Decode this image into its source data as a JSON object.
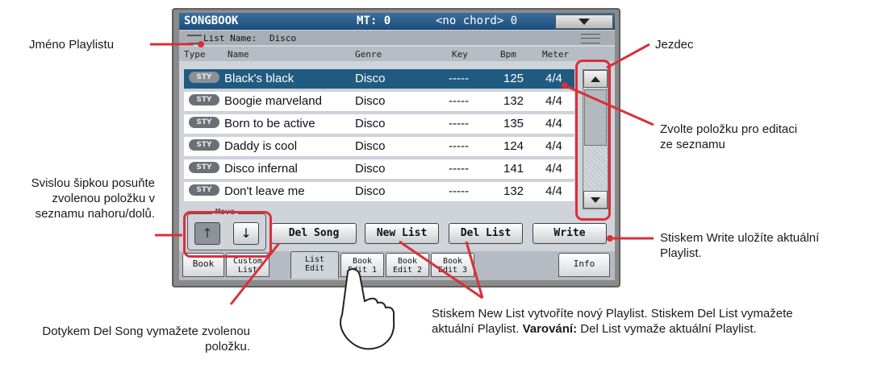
{
  "screen": {
    "title": "SONGBOOK",
    "mt": "MT: 0",
    "chord": "<no chord> 0",
    "list_name_label": "List Name:",
    "list_name_value": "Disco",
    "columns": [
      "Type",
      "Name",
      "Genre",
      "Key",
      "Bpm",
      "Meter"
    ],
    "rows": [
      {
        "type": "STY",
        "name": "Black's black",
        "genre": "Disco",
        "key": "-----",
        "bpm": "125",
        "meter": "4/4",
        "selected": true
      },
      {
        "type": "STY",
        "name": "Boogie marveland",
        "genre": "Disco",
        "key": "-----",
        "bpm": "132",
        "meter": "4/4",
        "selected": false
      },
      {
        "type": "STY",
        "name": "Born to be active",
        "genre": "Disco",
        "key": "-----",
        "bpm": "135",
        "meter": "4/4",
        "selected": false
      },
      {
        "type": "STY",
        "name": "Daddy is cool",
        "genre": "Disco",
        "key": "-----",
        "bpm": "124",
        "meter": "4/4",
        "selected": false
      },
      {
        "type": "STY",
        "name": "Disco infernal",
        "genre": "Disco",
        "key": "-----",
        "bpm": "141",
        "meter": "4/4",
        "selected": false
      },
      {
        "type": "STY",
        "name": "Don't leave me",
        "genre": "Disco",
        "key": "-----",
        "bpm": "132",
        "meter": "4/4",
        "selected": false
      }
    ],
    "move_label": "Move",
    "move_up": "↑",
    "move_down": "↓",
    "buttons": {
      "del_song": "Del Song",
      "new_list": "New List",
      "del_list": "Del List",
      "write": "Write"
    },
    "tabs": [
      "Book",
      "Custom\nList",
      "List\nEdit",
      "Book\nEdit 1",
      "Book\nEdit 2",
      "Book\nEdit 3",
      "Info"
    ],
    "active_tab": "List Edit"
  },
  "callouts": {
    "playlist_name": "Jméno Playlistu",
    "slider": "Jezdec",
    "select_item": "Zvolte položku pro editaci ze seznamu",
    "move_arrows": "Svislou šipkou posuňte zvolenou položku v seznamu nahoru/dolů.",
    "write": "Stiskem Write uložíte aktuální Playlist.",
    "del_song": "Dotykem Del Song vymažete zvolenou položku.",
    "new_del_list_part1": "Stiskem New List vytvoříte nový Playlist. Stiskem Del List vymažete aktuální Playlist.",
    "warning_label": "Varování:",
    "new_del_list_part2": "Del List vymaže aktuální Playlist."
  },
  "colors": {
    "callout_line": "#d8303a",
    "selected_row": "#1f5a80",
    "title_bar": "#1d4d7a"
  }
}
